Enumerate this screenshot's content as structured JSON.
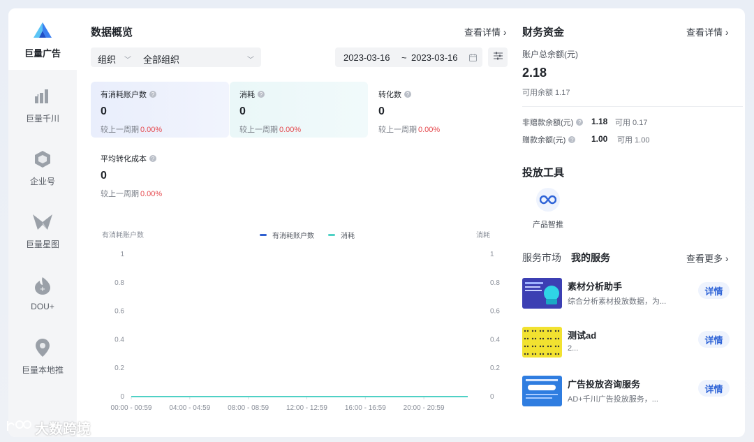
{
  "sidebar": {
    "items": [
      {
        "label": "巨量广告",
        "icon": "ocean-engine-logo-icon",
        "active": true
      },
      {
        "label": "巨量千川",
        "icon": "qianchuan-icon"
      },
      {
        "label": "企业号",
        "icon": "enterprise-account-icon"
      },
      {
        "label": "巨量星图",
        "icon": "xingtu-icon"
      },
      {
        "label": "DOU+",
        "icon": "dou-plus-icon"
      },
      {
        "label": "巨量本地推",
        "icon": "local-promotion-icon"
      }
    ]
  },
  "overview": {
    "title": "数据概览",
    "more": "查看详情",
    "org_select": {
      "label": "组织",
      "value": "全部组织"
    },
    "date_range": {
      "start": "2023-03-16",
      "sep": "~",
      "end": "2023-03-16"
    },
    "metrics": [
      {
        "label": "有消耗账户数",
        "value": "0",
        "cmp_label": "较上一周期",
        "cmp_value": "0.00%"
      },
      {
        "label": "消耗",
        "value": "0",
        "cmp_label": "较上一周期",
        "cmp_value": "0.00%"
      },
      {
        "label": "转化数",
        "value": "0",
        "cmp_label": "较上一周期",
        "cmp_value": "0.00%"
      },
      {
        "label": "平均转化成本",
        "value": "0",
        "cmp_label": "较上一周期",
        "cmp_value": "0.00%"
      }
    ]
  },
  "chart_data": {
    "type": "line",
    "left_axis_label": "有消耗账户数",
    "right_axis_label": "消耗",
    "x_ticks": [
      "00:00 - 00:59",
      "04:00 - 04:59",
      "08:00 - 08:59",
      "12:00 - 12:59",
      "16:00 - 16:59",
      "20:00 - 20:59"
    ],
    "y_ticks": [
      "0",
      "0.2",
      "0.4",
      "0.6",
      "0.8",
      "1"
    ],
    "ylim": [
      0,
      1
    ],
    "y2lim": [
      0,
      1
    ],
    "legend_position": "top-center",
    "grid": false,
    "series": [
      {
        "name": "有消耗账户数",
        "color": "#2f5fd0",
        "axis": "left",
        "values": [
          0,
          0,
          0,
          0,
          0,
          0,
          0,
          0,
          0,
          0,
          0,
          0,
          0,
          0,
          0,
          0,
          0,
          0,
          0,
          0,
          0,
          0,
          0,
          0
        ]
      },
      {
        "name": "消耗",
        "color": "#4fd1c5",
        "axis": "right",
        "values": [
          0,
          0,
          0,
          0,
          0,
          0,
          0,
          0,
          0,
          0,
          0,
          0,
          0,
          0,
          0,
          0,
          0,
          0,
          0,
          0,
          0,
          0,
          0,
          0
        ]
      }
    ]
  },
  "finance": {
    "title": "财务资金",
    "more": "查看详情",
    "total_label": "账户总余额(元)",
    "total_value": "2.18",
    "available": "可用余额 1.17",
    "rows": [
      {
        "label": "非赠款余额(元)",
        "value": "1.18",
        "available": "可用 0.17"
      },
      {
        "label": "赠款余额(元)",
        "value": "1.00",
        "available": "可用 1.00"
      }
    ]
  },
  "tools": {
    "title": "投放工具",
    "items": [
      {
        "label": "产品智推",
        "icon": "infinity-icon"
      }
    ]
  },
  "services": {
    "tab_market": "服务市场",
    "tab_mine": "我的服务",
    "more": "查看更多",
    "items": [
      {
        "name": "素材分析助手",
        "desc": "综合分析素材投放数据，为...",
        "button": "详情",
        "thumb_color": "#3c3fb3"
      },
      {
        "name": "测试ad",
        "desc": "2...",
        "button": "详情",
        "thumb_color": "#f2e230"
      },
      {
        "name": "广告投放咨询服务",
        "desc": "AD+千川广告投放服务，...",
        "button": "详情",
        "thumb_color": "#2f7de0"
      }
    ]
  },
  "watermark": "大数跨境"
}
